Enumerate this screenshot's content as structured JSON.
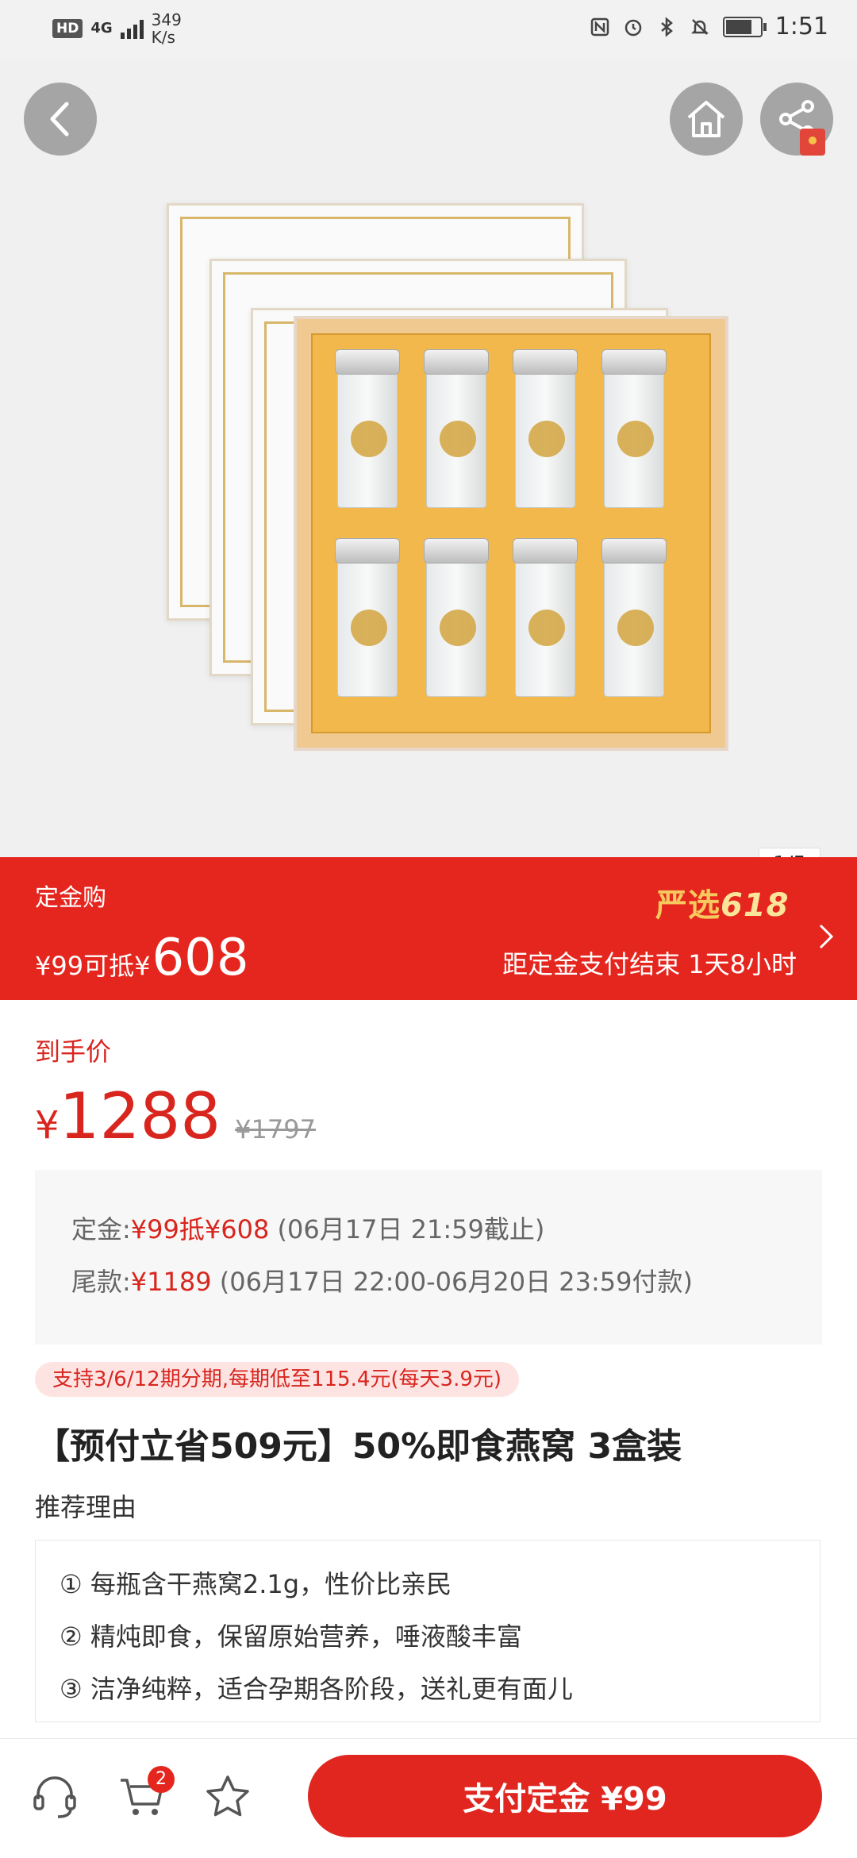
{
  "status_bar": {
    "hd": "HD",
    "network": "4G",
    "speed_value": "349",
    "speed_unit": "K/s",
    "time": "1:51"
  },
  "gallery": {
    "pager": "1/5"
  },
  "deposit_banner": {
    "title": "定金购",
    "deposit_text": "¥99可抵¥",
    "deposit_value": "608",
    "logo_text": "严选",
    "logo_num": "618",
    "countdown": "距定金支付结束 1天8小时"
  },
  "price": {
    "label": "到手价",
    "currency": "¥",
    "value": "1288",
    "original": "¥1797"
  },
  "payment_schedule": {
    "deposit_label": "定金:",
    "deposit_value": "¥99抵¥608",
    "deposit_note": " (06月17日 21:59截止)",
    "balance_label": "尾款:",
    "balance_value": "¥1189",
    "balance_note": " (06月17日 22:00-06月20日 23:59付款)"
  },
  "installment": "支持3/6/12期分期,每期低至115.4元(每天3.9元)",
  "product_title": "【预付立省509元】50%即食燕窝 3盒装",
  "reasons": {
    "label": "推荐理由",
    "items": [
      "① 每瓶含干燕窝2.1g，性价比亲民",
      "② 精炖即食，保留原始营养，唾液酸丰富",
      "③ 洁净纯粹，适合孕期各阶段，送礼更有面儿"
    ]
  },
  "bottom_bar": {
    "cart_count": "2",
    "pay_button": "支付定金 ¥99"
  },
  "colors": {
    "brand_red": "#e5261e",
    "price_red": "#d8261f",
    "logo_gold": "#f6c95f"
  }
}
